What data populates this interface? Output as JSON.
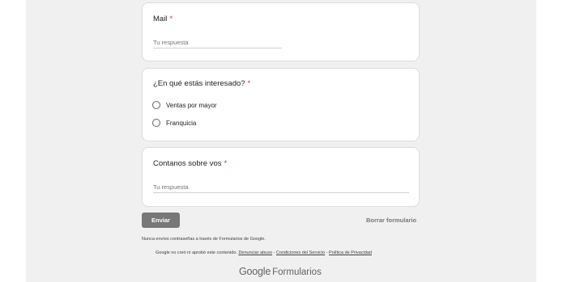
{
  "questions": {
    "mail": {
      "title": "Mail",
      "required_mark": "*",
      "answer_placeholder": "Tu respuesta"
    },
    "interest": {
      "title": "¿En qué estás interesado?",
      "required_mark": "*",
      "options": [
        "Ventas por mayor",
        "Franquicia"
      ]
    },
    "contanos": {
      "title": "Contanos sobre vos",
      "required_mark": "*",
      "answer_placeholder": "Tu respuesta"
    }
  },
  "actions": {
    "submit_label": "Enviar",
    "clear_label": "Borrar formulario"
  },
  "footer": {
    "warning": "Nunca envíes contraseñas a través de Formularios de Google.",
    "disclaimer_text": "Google no creó ni aprobó este contenido.",
    "report_abuse": "Denunciar abuso",
    "terms": "Condiciones del Servicio",
    "privacy": "Política de Privacidad",
    "separator": " - ",
    "logo_google": "Google",
    "logo_product": "Formularios"
  },
  "colors": {
    "page_background": "#f0f0f0",
    "card_background": "#ffffff",
    "required_asterisk": "#d93025",
    "submit_button": "#777777"
  }
}
